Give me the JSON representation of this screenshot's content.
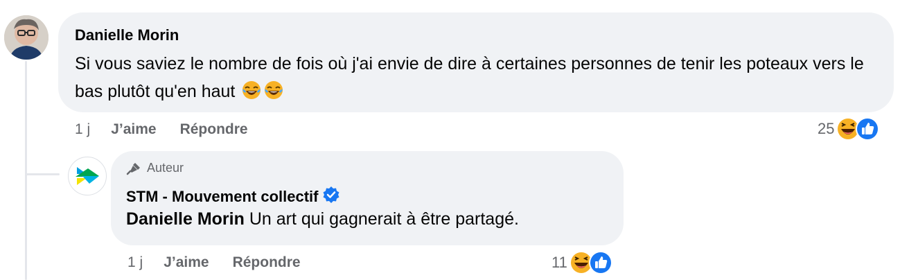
{
  "comment": {
    "author": "Danielle Morin",
    "text": "Si vous saviez le nombre de fois où j'ai envie de dire à certaines personnes de tenir les poteaux vers le bas plutôt qu'en haut",
    "inline_emojis": [
      "laughing-with-tears",
      "laughing-with-tears"
    ],
    "time": "1 j",
    "like_label": "J’aime",
    "reply_label": "Répondre",
    "reaction_count": "25",
    "reaction_icons": [
      "haha-reaction",
      "like-reaction"
    ]
  },
  "reply": {
    "badge": "Auteur",
    "author": "STM - Mouvement collectif",
    "verified": true,
    "mention": "Danielle Morin",
    "text": " Un art qui gagnerait à être partagé.",
    "time": "1 j",
    "like_label": "J’aime",
    "reply_label": "Répondre",
    "reaction_count": "11",
    "reaction_icons": [
      "haha-reaction",
      "like-reaction"
    ]
  },
  "colors": {
    "bubble": "#f0f2f5",
    "secondary_text": "#65676b",
    "like_blue": "#1877f2",
    "haha_yellow": "#f7b125",
    "verified_blue": "#1877f2"
  }
}
